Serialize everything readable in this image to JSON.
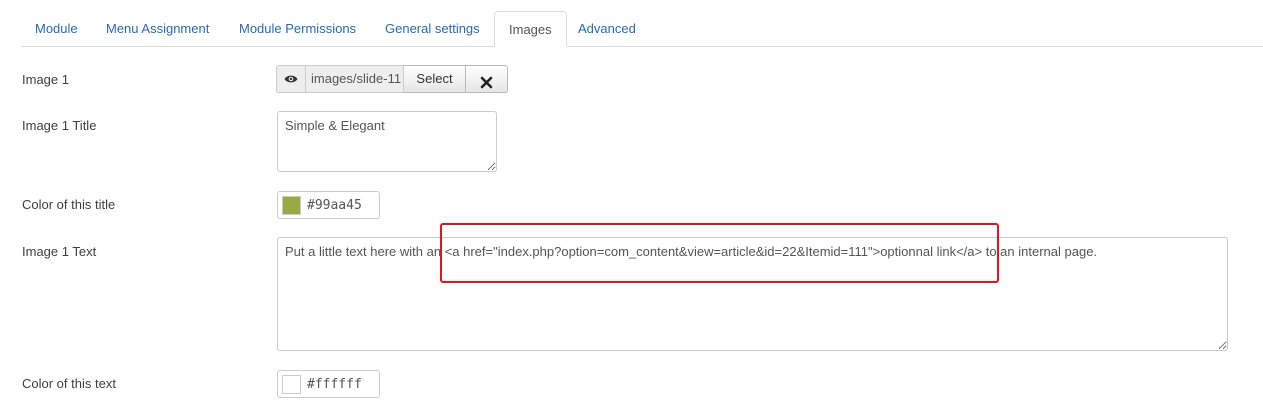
{
  "tabs": [
    {
      "label": "Module",
      "active": false
    },
    {
      "label": "Menu Assignment",
      "active": false
    },
    {
      "label": "Module Permissions",
      "active": false
    },
    {
      "label": "General settings",
      "active": false
    },
    {
      "label": "Images",
      "active": true
    },
    {
      "label": "Advanced",
      "active": false
    }
  ],
  "fields": {
    "image1": {
      "label": "Image 1",
      "value": "images/slide-11",
      "select_label": "Select",
      "preview_icon": "eye-icon",
      "clear_icon": "x-icon"
    },
    "image1_title": {
      "label": "Image 1 Title",
      "value": "Simple & Elegant"
    },
    "title_color": {
      "label": "Color of this title",
      "value": "#99aa45"
    },
    "image1_text": {
      "label": "Image 1 Text",
      "value": "Put a little text here with an <a href=\"index.php?option=com_content&view=article&id=22&Itemid=111\">optionnal link</a> to an internal page."
    },
    "text_color": {
      "label": "Color of this text",
      "value": "#ffffff"
    }
  },
  "colors": {
    "link": "#2a69b8",
    "highlight": "#e8141c"
  }
}
